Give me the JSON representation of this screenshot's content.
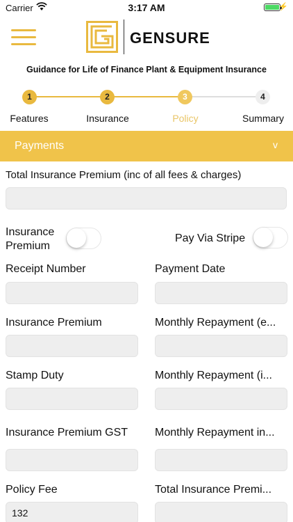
{
  "status": {
    "carrier": "Carrier",
    "time": "3:17 AM",
    "battery_level": 1.0
  },
  "header": {
    "brand": "GENSURE",
    "logo_icon": "gensure-logo-icon",
    "menu_icon": "hamburger-menu-icon"
  },
  "subtitle": "Guidance for Life of Finance Plant & Equipment Insurance",
  "stepper": {
    "steps": [
      {
        "number": "1",
        "label": "Features",
        "state": "done"
      },
      {
        "number": "2",
        "label": "Insurance",
        "state": "done"
      },
      {
        "number": "3",
        "label": "Policy",
        "state": "active"
      },
      {
        "number": "4",
        "label": "Summary",
        "state": "todo"
      }
    ]
  },
  "section": {
    "title": "Payments",
    "chevron": "v"
  },
  "form": {
    "total_premium_label": "Total Insurance Premium (inc of all fees & charges)",
    "total_premium_value": "",
    "insurance_premium_toggle_label": "Insurance Premium",
    "insurance_premium_toggle_on": false,
    "pay_via_stripe_label": "Pay Via Stripe",
    "pay_via_stripe_on": false,
    "receipt_number_label": "Receipt Number",
    "receipt_number_value": "",
    "payment_date_label": "Payment Date",
    "payment_date_value": "",
    "insurance_premium_label": "Insurance Premium",
    "insurance_premium_value": "",
    "monthly_repayment_e_label": "Monthly Repayment (e...",
    "monthly_repayment_e_value": "",
    "stamp_duty_label": "Stamp Duty",
    "stamp_duty_value": "",
    "monthly_repayment_i_label": "Monthly Repayment (i...",
    "monthly_repayment_i_value": "",
    "premium_gst_label": "Insurance Premium GST",
    "premium_gst_value": "",
    "monthly_repayment_in_label": "Monthly Repayment in...",
    "monthly_repayment_in_value": "",
    "policy_fee_label": "Policy Fee",
    "policy_fee_value": "132",
    "total_premium_short_label": "Total Insurance Premi...",
    "total_premium_short_value": ""
  },
  "colors": {
    "accent": "#e9b93f",
    "section_bar": "#f0c34a",
    "field_bg": "#eeeeee"
  }
}
